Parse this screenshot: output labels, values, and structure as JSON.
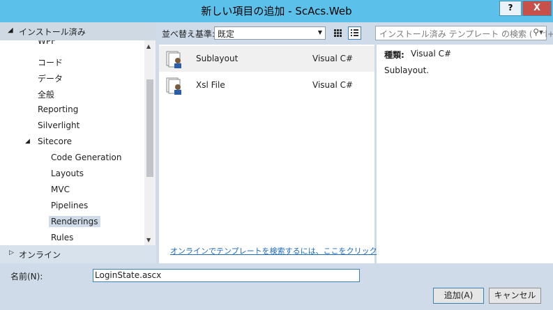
{
  "window": {
    "title": "新しい項目の追加 - ScAcs.Web",
    "help_label": "?",
    "close_label": "X"
  },
  "tree": {
    "header_label": "インストール済み",
    "items": [
      {
        "label": "WPF"
      },
      {
        "label": "コード"
      },
      {
        "label": "データ"
      },
      {
        "label": "全般"
      },
      {
        "label": "Reporting"
      },
      {
        "label": "Silverlight"
      },
      {
        "label": "Sitecore"
      },
      {
        "label": "Code Generation"
      },
      {
        "label": "Layouts"
      },
      {
        "label": "MVC"
      },
      {
        "label": "Pipelines"
      },
      {
        "label": "Renderings"
      },
      {
        "label": "Rules"
      }
    ],
    "online_label": "オンライン"
  },
  "toolbar": {
    "sort_label": "並べ替え基準:",
    "sort_value": "既定",
    "search_placeholder": "インストール済み テンプレート の検索 (Ctrl+E)"
  },
  "templates": [
    {
      "name": "Sublayout",
      "lang": "Visual C#"
    },
    {
      "name": "Xsl File",
      "lang": "Visual C#"
    }
  ],
  "online_link": "オンラインでテンプレートを検索するには、ここをクリックします。",
  "details": {
    "type_label": "種類:",
    "type_value": "Visual C#",
    "description": "Sublayout."
  },
  "footer": {
    "name_label": "名前(N):",
    "name_value": "LoginState.ascx",
    "add_label": "追加(A)",
    "cancel_label": "キャンセル"
  },
  "colors": {
    "titlebar": "#5bc1ea",
    "close_button": "#c7504a",
    "selection": "#cfdbe8",
    "link": "#1e6bb8"
  }
}
